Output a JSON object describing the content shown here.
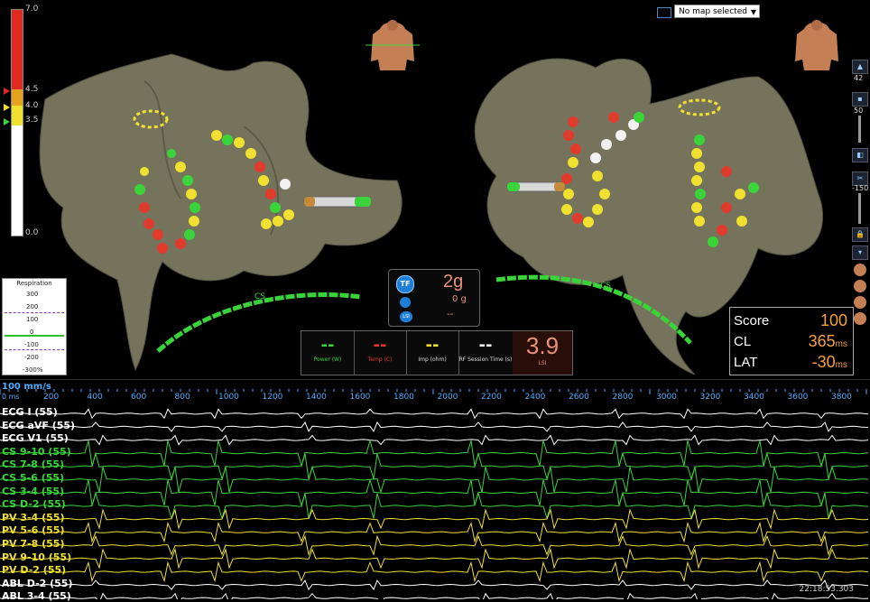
{
  "colors": {
    "green": "#3ad43a",
    "yellow": "#f0e030",
    "red": "#e03b2c",
    "white": "#f2f2f2",
    "orange": "#f4a13c",
    "accent": "#4aa0ff"
  },
  "scale": {
    "top": "7.0",
    "mid_high": "4.5",
    "mid": "4.0",
    "mid_low": "3.5",
    "bottom": "0.0"
  },
  "map_selector": {
    "value": "No map selected"
  },
  "respiration": {
    "title": "Respiration",
    "ticks": [
      "300",
      "200",
      "100",
      "0",
      "-100",
      "-200",
      "-300%"
    ]
  },
  "catheter_labels": {
    "left": "CS",
    "right": "CS"
  },
  "contact": {
    "tf_icon": "TF",
    "force": "2g",
    "sub_force": "0 g",
    "lsi_row": "--"
  },
  "metrics": [
    {
      "label": "Power (W)",
      "value": "--",
      "color": "#3ad43a"
    },
    {
      "label": "Temp (C)",
      "value": "--",
      "color": "#e03b2c"
    },
    {
      "label": "Imp (ohm)",
      "value": "--",
      "color": "#f0e030"
    },
    {
      "label": "RF Session Time (s)",
      "value": "--",
      "color": "#f2f2f2"
    },
    {
      "label": "LSI",
      "value": "3.9",
      "color": "#f4a13c"
    }
  ],
  "score_panel": {
    "score_label": "Score",
    "score_value": "100",
    "cl_label": "CL",
    "cl_value": "365",
    "cl_unit": "ms",
    "lat_label": "LAT",
    "lat_value": "-30",
    "lat_unit": "ms"
  },
  "toolbar": {
    "zoom_value": "42",
    "slider1_value": "50",
    "slider2_value": "-150"
  },
  "timescale": {
    "speed": "100 mm/s",
    "start": "0 ms",
    "ticks": [
      "200",
      "400",
      "600",
      "800",
      "1000",
      "1200",
      "1400",
      "1600",
      "1800",
      "2000",
      "2200",
      "2400",
      "2600",
      "2800",
      "3000",
      "3200",
      "3400",
      "3600",
      "3800",
      "4"
    ]
  },
  "traces": [
    {
      "label": "ECG I (55)",
      "color": "#ffffff"
    },
    {
      "label": "ECG aVF (55)",
      "color": "#ffffff"
    },
    {
      "label": "ECG V1 (55)",
      "color": "#ffffff"
    },
    {
      "label": "CS  9-10 (55)",
      "color": "#3ad43a"
    },
    {
      "label": "CS  7-8 (55)",
      "color": "#3ad43a"
    },
    {
      "label": "CS  5-6 (55)",
      "color": "#3ad43a"
    },
    {
      "label": "CS  3-4 (55)",
      "color": "#3ad43a"
    },
    {
      "label": "CS  D-2 (55)",
      "color": "#3ad43a"
    },
    {
      "label": "PV   3-4 (55)",
      "color": "#f0e030"
    },
    {
      "label": "PV   5-6 (55)",
      "color": "#f0e030"
    },
    {
      "label": "PV   7-8 (55)",
      "color": "#f0e030"
    },
    {
      "label": "PV   9-10 (55)",
      "color": "#f0e030"
    },
    {
      "label": "PV   D-2 (55)",
      "color": "#f0e030"
    },
    {
      "label": "ABL   D-2 (55)",
      "color": "#ffffff"
    },
    {
      "label": "ABL   3-4 (55)",
      "color": "#ffffff"
    }
  ],
  "timestamp": "22:18:53.303"
}
